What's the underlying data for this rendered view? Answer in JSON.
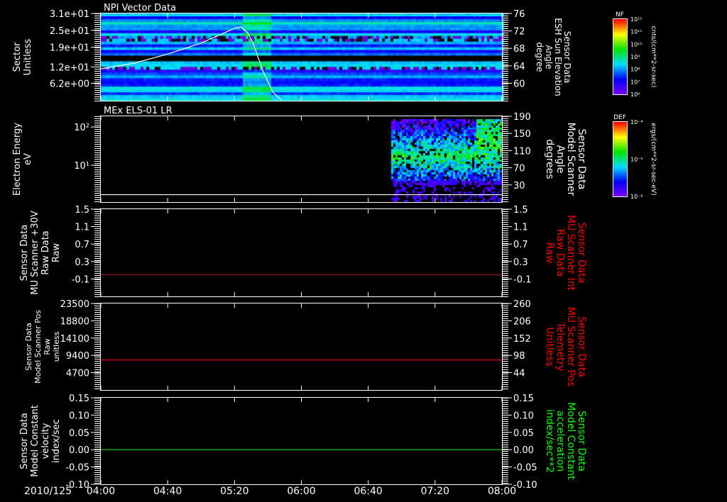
{
  "date_label": "2010/125",
  "chart_data": [
    {
      "type": "heatmap",
      "title": "NPI Vector Data",
      "left_axis": {
        "label": [
          "Sector",
          "Unitless"
        ],
        "ylim": [
          0,
          31
        ],
        "ticks": [
          {
            "label": "3.1e+01",
            "v": 31
          },
          {
            "label": "2.5e+01",
            "v": 25
          },
          {
            "label": "1.9e+01",
            "v": 19
          },
          {
            "label": "1.2e+01",
            "v": 12
          },
          {
            "label": "6.2e+00",
            "v": 6.2
          }
        ]
      },
      "right_axis": {
        "label": [
          "Sensor Data",
          "ESH Sun Elevation",
          "Angle",
          "degree"
        ],
        "color": "#ffffff",
        "ylim": [
          56,
          76
        ],
        "ticks": [
          {
            "label": "76",
            "v": 76
          },
          {
            "label": "72",
            "v": 72
          },
          {
            "label": "68",
            "v": 68
          },
          {
            "label": "64",
            "v": 64
          },
          {
            "label": "60",
            "v": 60
          }
        ]
      },
      "series": [
        {
          "axis": "right",
          "color": "#ffffff",
          "x_minutes_after_0400": [
            0,
            20,
            40,
            60,
            80,
            84,
            88,
            91,
            97,
            103,
            108
          ],
          "y": [
            63.3,
            64.6,
            66.7,
            69.2,
            72.6,
            72.9,
            71.5,
            69.3,
            62.8,
            57.9,
            56.2
          ]
        }
      ],
      "colorbar": {
        "title": "NF",
        "units": "cnts/(cm**2-sr-sec)",
        "ticks": [
          "10¹²",
          "10¹¹",
          "10¹⁰",
          "10⁹",
          "10⁸",
          "10⁷",
          "10⁶"
        ]
      }
    },
    {
      "type": "heatmap",
      "title": "MEx ELS-01 LR",
      "left_axis": {
        "label": [
          "Electron Energy",
          "eV"
        ],
        "log": true,
        "ylim": [
          1.09,
          190
        ],
        "ticks": [
          {
            "label": "10²",
            "v": 100
          },
          {
            "label": "10¹",
            "v": 10
          }
        ]
      },
      "right_axis": {
        "label": [
          "Sensor Data",
          "Model Scanner",
          "Angle",
          "degrees"
        ],
        "color": "#ffffff",
        "ylim": [
          -10,
          190
        ],
        "ticks": [
          {
            "label": "190",
            "v": 190
          },
          {
            "label": "150",
            "v": 150
          },
          {
            "label": "110",
            "v": 110
          },
          {
            "label": "70",
            "v": 70
          },
          {
            "label": "30",
            "v": 30
          }
        ]
      },
      "series": [
        {
          "axis": "left",
          "color": "#ffffff",
          "x_minutes_after_0400": [
            0,
            240
          ],
          "y": [
            1.7,
            1.7
          ]
        }
      ],
      "colorbar": {
        "title": "DEF",
        "units": "ergs/(cm**2-sr-sec-eV)",
        "ticks": [
          "10⁻⁴",
          "10⁻⁵",
          "10⁻⁶"
        ]
      }
    },
    {
      "type": "line",
      "left_axis": {
        "label": [
          "Sensor Data",
          "MU Scanner +30V",
          "Raw Data",
          "Raw"
        ],
        "ylim": [
          -0.5,
          1.5
        ],
        "ticks": [
          {
            "label": "1.5",
            "v": 1.5
          },
          {
            "label": "1.1",
            "v": 1.1
          },
          {
            "label": "0.7",
            "v": 0.7
          },
          {
            "label": "0.3",
            "v": 0.3
          },
          {
            "label": "-0.1",
            "v": -0.1
          }
        ]
      },
      "right_axis": {
        "label": [
          "Sensor Data",
          "MU Scanner Int",
          "Raw Data",
          "Raw"
        ],
        "color": "#ff0000",
        "ylim": [
          -0.5,
          1.5
        ],
        "ticks": [
          {
            "label": "1.5",
            "v": 1.5
          },
          {
            "label": "1.1",
            "v": 1.1
          },
          {
            "label": "0.7",
            "v": 0.7
          },
          {
            "label": "0.3",
            "v": 0.3
          },
          {
            "label": "-0.1",
            "v": -0.1
          }
        ]
      },
      "series": [
        {
          "axis": "left",
          "color": "#a01010",
          "x_minutes_after_0400": [
            0,
            240
          ],
          "y": [
            0,
            0
          ]
        }
      ]
    },
    {
      "type": "line",
      "left_axis": {
        "label": [
          "Sensor Data",
          "Model Scanner Pos",
          "Raw",
          "unitless"
        ],
        "ylim": [
          0,
          23500
        ],
        "ticks": [
          {
            "label": "23500",
            "v": 23500
          },
          {
            "label": "18800",
            "v": 18800
          },
          {
            "label": "14100",
            "v": 14100
          },
          {
            "label": "9400",
            "v": 9400
          },
          {
            "label": "4700",
            "v": 4700
          }
        ]
      },
      "right_axis": {
        "label": [
          "Sensor Data",
          "MU Scanner Pos",
          "Telemetry",
          "Unitless"
        ],
        "color": "#ff0000",
        "ylim": [
          -10,
          260
        ],
        "ticks": [
          {
            "label": "260",
            "v": 260
          },
          {
            "label": "206",
            "v": 206
          },
          {
            "label": "152",
            "v": 152
          },
          {
            "label": "98",
            "v": 98
          },
          {
            "label": "44",
            "v": 44
          }
        ]
      },
      "series": [
        {
          "axis": "left",
          "color": "#ff0000",
          "x_minutes_after_0400": [
            0,
            240
          ],
          "y": [
            8150,
            8150
          ]
        }
      ]
    },
    {
      "type": "line",
      "left_axis": {
        "label": [
          "Sensor Data",
          "Model Constant",
          "velocity",
          "index/sec"
        ],
        "ylim": [
          -0.1,
          0.15
        ],
        "ticks": [
          {
            "label": "0.15",
            "v": 0.15
          },
          {
            "label": "0.10",
            "v": 0.1
          },
          {
            "label": "0.05",
            "v": 0.05
          },
          {
            "label": "0.00",
            "v": 0
          },
          {
            "label": "-0.05",
            "v": -0.05
          },
          {
            "label": "-0.10",
            "v": -0.1
          }
        ]
      },
      "right_axis": {
        "label": [
          "Sensor Data",
          "Model Constant",
          "acceleration",
          "index/sec**2"
        ],
        "color": "#00ff00",
        "ylim": [
          -0.1,
          0.15
        ],
        "ticks": [
          {
            "label": "0.15",
            "v": 0.15
          },
          {
            "label": "0.10",
            "v": 0.1
          },
          {
            "label": "0.05",
            "v": 0.05
          },
          {
            "label": "0.00",
            "v": 0
          },
          {
            "label": "-0.05",
            "v": -0.05
          },
          {
            "label": "-0.10",
            "v": -0.1
          }
        ]
      },
      "series": [
        {
          "axis": "left",
          "color": "#00dd00",
          "x_minutes_after_0400": [
            0,
            240
          ],
          "y": [
            0,
            0
          ]
        }
      ]
    }
  ],
  "x_axis": {
    "ticks": [
      "04:00",
      "04:40",
      "05:20",
      "06:00",
      "06:40",
      "07:20",
      "08:00"
    ]
  }
}
